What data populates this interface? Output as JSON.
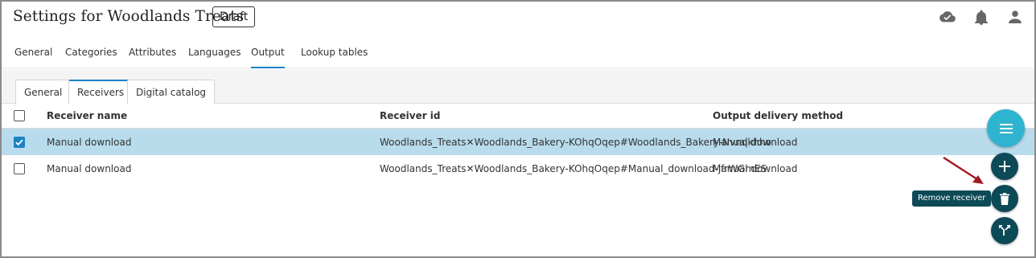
{
  "header": {
    "title": "Settings for Woodlands Treats",
    "badge": "Draft",
    "icons": [
      "cloud-done-icon",
      "bell-icon",
      "user-icon"
    ]
  },
  "main_tabs": [
    {
      "label": "General"
    },
    {
      "label": "Categories"
    },
    {
      "label": "Attributes"
    },
    {
      "label": "Languages"
    },
    {
      "label": "Output",
      "active": true
    },
    {
      "label": "Lookup tables"
    }
  ],
  "sub_tabs": [
    {
      "label": "General"
    },
    {
      "label": "Receivers",
      "active": true
    },
    {
      "label": "Digital catalog"
    }
  ],
  "table": {
    "columns": [
      "Receiver name",
      "Receiver id",
      "Output delivery method"
    ],
    "rows": [
      {
        "checked": true,
        "name": "Manual download",
        "id": "Woodlands_Treats✕Woodlands_Bakery-KOhqOqep#Woodlands_Bakery-Nvnqkhho",
        "method": "Manual download"
      },
      {
        "checked": false,
        "name": "Manual download",
        "id": "Woodlands_Treats✕Woodlands_Bakery-KOhqOqep#Manual_download-jfrWGmES",
        "method": "Manual download"
      }
    ]
  },
  "fab": {
    "tooltip": "Remove receiver",
    "icons": [
      "menu-icon",
      "plus-icon",
      "trash-icon",
      "split-icon"
    ]
  },
  "colors": {
    "accent": "#1b82c4",
    "selected_row": "#b8dcec",
    "fab_primary": "#2fb4cf",
    "fab_dark": "#0d4a57",
    "annotation_arrow": "#a01c22"
  }
}
